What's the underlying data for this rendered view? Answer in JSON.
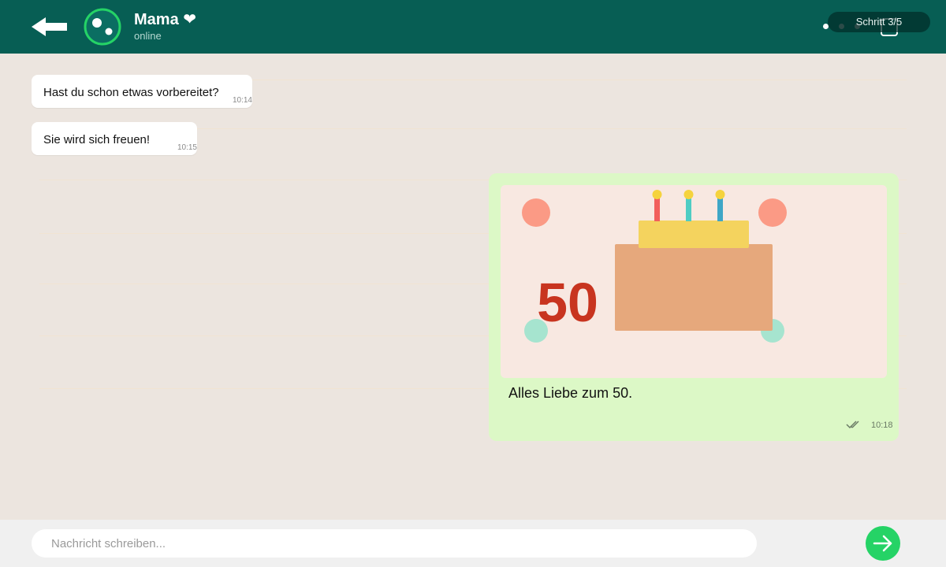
{
  "header": {
    "contact_name": "Mama ❤",
    "status": "online",
    "step_badge": "Schritt 3/5",
    "icons": {
      "back": "arrow-left-icon",
      "avatar": "avatar-icon",
      "menu": "more-dots-icon",
      "camera": "camera-icon"
    }
  },
  "messages": [
    {
      "direction": "incoming",
      "text": "Hast du schon etwas vorbereitet?",
      "time": "10:14"
    },
    {
      "direction": "incoming",
      "text": "Sie wird sich freuen!",
      "time": "10:15"
    },
    {
      "direction": "outgoing",
      "type": "image",
      "image_text": "50",
      "caption": "Alles Liebe zum 50.",
      "time": "10:18",
      "status": "read"
    }
  ],
  "composer": {
    "placeholder": "Nachricht schreiben...",
    "value": "",
    "send_icon": "send-arrow-icon"
  },
  "colors": {
    "header": "#075e54",
    "chat_background": "#ece5df",
    "incoming_bubble": "#ffffff",
    "outgoing_bubble": "#dcf8c6",
    "send_button": "#25d366",
    "cake_number": "#c8341f"
  }
}
